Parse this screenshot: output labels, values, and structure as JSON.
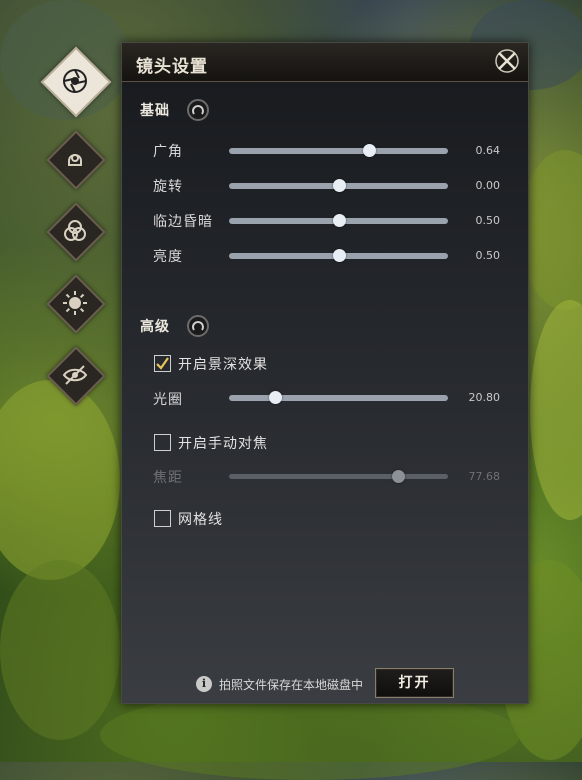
{
  "panel": {
    "title": "镜头设置"
  },
  "basic": {
    "title": "基础",
    "sliders": [
      {
        "label": "广角",
        "value": "0.64",
        "fraction": 0.64
      },
      {
        "label": "旋转",
        "value": "0.00",
        "fraction": 0.5
      },
      {
        "label": "临边昏暗",
        "value": "0.50",
        "fraction": 0.5
      },
      {
        "label": "亮度",
        "value": "0.50",
        "fraction": 0.5
      }
    ]
  },
  "advanced": {
    "title": "高级",
    "depth_of_field": {
      "label": "开启景深效果",
      "checked": true
    },
    "aperture": {
      "label": "光圈",
      "value": "20.80",
      "fraction": 0.21
    },
    "manual_focus": {
      "label": "开启手动对焦",
      "checked": false
    },
    "focal_distance": {
      "label": "焦距",
      "value": "77.68",
      "fraction": 0.77,
      "disabled": true
    },
    "grid": {
      "label": "网格线",
      "checked": false
    }
  },
  "footer": {
    "info_icon": "i",
    "message": "拍照文件保存在本地磁盘中",
    "open_label": "打开"
  },
  "rail": [
    "camera-aperture-icon",
    "portrait-icon",
    "filter-circles-icon",
    "sun-icon",
    "hide-eye-icon"
  ]
}
